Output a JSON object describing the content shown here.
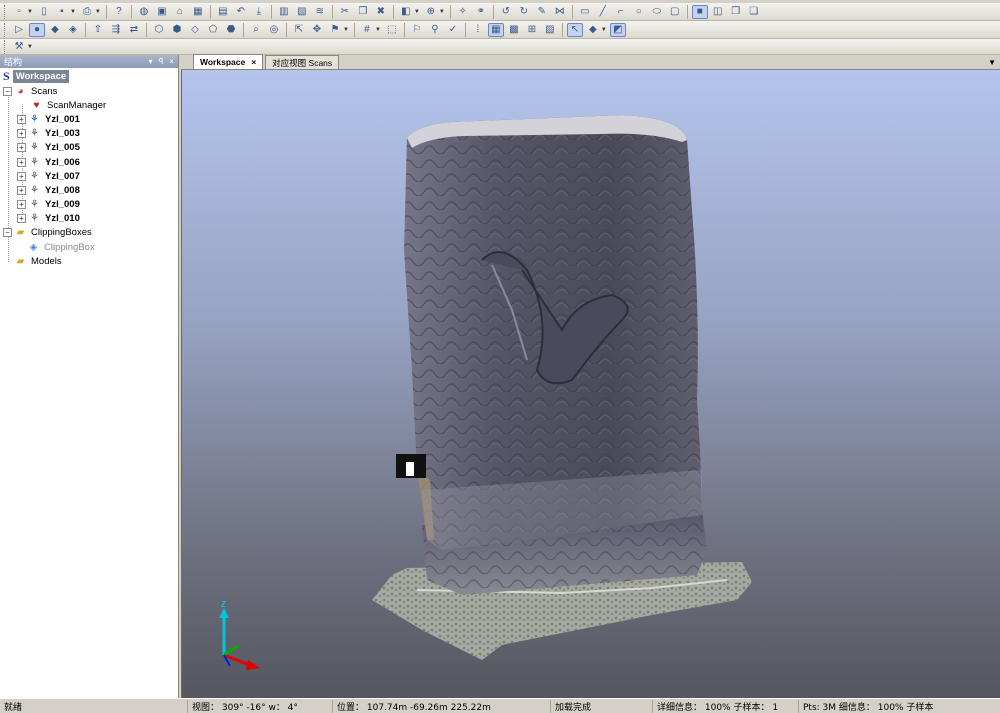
{
  "toolbars": {
    "row1": [
      "new-file",
      "open-file",
      "save",
      "print",
      "help",
      "scan",
      "3d",
      "home",
      "img",
      "list",
      "doc",
      "export",
      "layout",
      "layout2",
      "wave",
      "cut",
      "paste",
      "redo",
      "img2",
      "zoom",
      "wand",
      "link",
      "undo",
      "redo2",
      "brush",
      "fence",
      "rect",
      "line",
      "arrow",
      "circle",
      "ellipse",
      "rect2",
      "win1",
      "win2",
      "win3",
      "win4"
    ],
    "row2": [
      "folder-open",
      "sphere",
      "shapes",
      "pen",
      "arrow-up",
      "arrow-green",
      "cube1",
      "cube2",
      "cube3",
      "cube4",
      "cube5",
      "search",
      "orbit",
      "nav1",
      "nav2",
      "nav3",
      "grid",
      "select",
      "flag",
      "mark",
      "pin",
      "dots",
      "grid2",
      "grid3",
      "zoom2",
      "wall",
      "cursor",
      "model",
      "cube6"
    ]
  },
  "panel": {
    "title": "结构",
    "pin_icon": "▾ ᵖ ×"
  },
  "tree": {
    "root": "Workspace",
    "scans": "Scans",
    "scan_manager": "ScanManager",
    "scan_items": [
      "Yzl_001",
      "Yzl_003",
      "Yzl_005",
      "Yzl_006",
      "Yzl_007",
      "Yzl_008",
      "Yzl_009",
      "Yzl_010"
    ],
    "clipping_boxes": "ClippingBoxes",
    "clipping_box": "ClippingBox",
    "models": "Models"
  },
  "tabs": [
    {
      "label": "Workspace",
      "active": true
    },
    {
      "label": "对应视图 Scans",
      "active": false
    }
  ],
  "statusbar": {
    "ready": "就绪",
    "view": "视图： 309° -16° w： 4°",
    "position": "位置： 107.74m -69.26m 225.22m",
    "load": "加载完成",
    "detail": "详细信息： 100%  子样本：  1",
    "pts": "Pts: 3M  细信息： 100%  子样本"
  },
  "axis": {
    "z": "Z"
  },
  "colors": {
    "accent": "#7b8594",
    "sky_top": "#b4c4ec",
    "sky_bottom": "#55565e",
    "stone": "#5a5a6e"
  }
}
